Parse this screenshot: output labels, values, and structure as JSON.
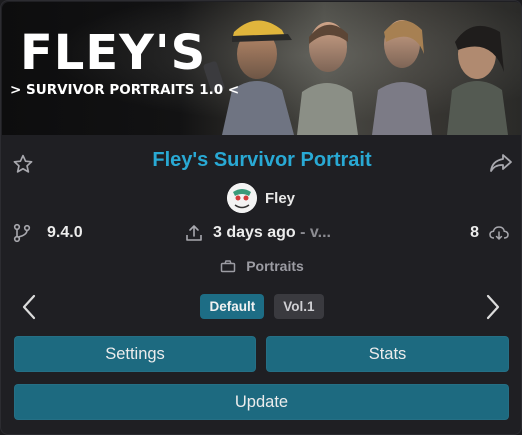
{
  "banner": {
    "title": "FLEY'S",
    "subtitle": "> SURVIVOR PORTRAITS 1.0 <"
  },
  "mod": {
    "title": "Fley's Survivor Portrait",
    "author": "Fley",
    "version": "9.4.0",
    "updated": "3 days ago",
    "updated_suffix": "- v...",
    "downloads": "8",
    "category": "Portraits"
  },
  "variants": {
    "items": [
      "Default",
      "Vol.1"
    ],
    "selected": "Default"
  },
  "actions": {
    "settings": "Settings",
    "stats": "Stats",
    "update": "Update"
  },
  "colors": {
    "accent": "#29a9d4",
    "button": "#1d6a80",
    "pill_active": "#1d6d85",
    "pill_inactive": "#3a3a3f"
  },
  "icons": {
    "favorite": "star-outline-icon",
    "share": "share-arrow-icon",
    "version": "git-branch-icon",
    "updated": "upload-icon",
    "downloads": "cloud-download-icon",
    "category": "category-tag-icon",
    "prev": "chevron-left-icon",
    "next": "chevron-right-icon"
  }
}
